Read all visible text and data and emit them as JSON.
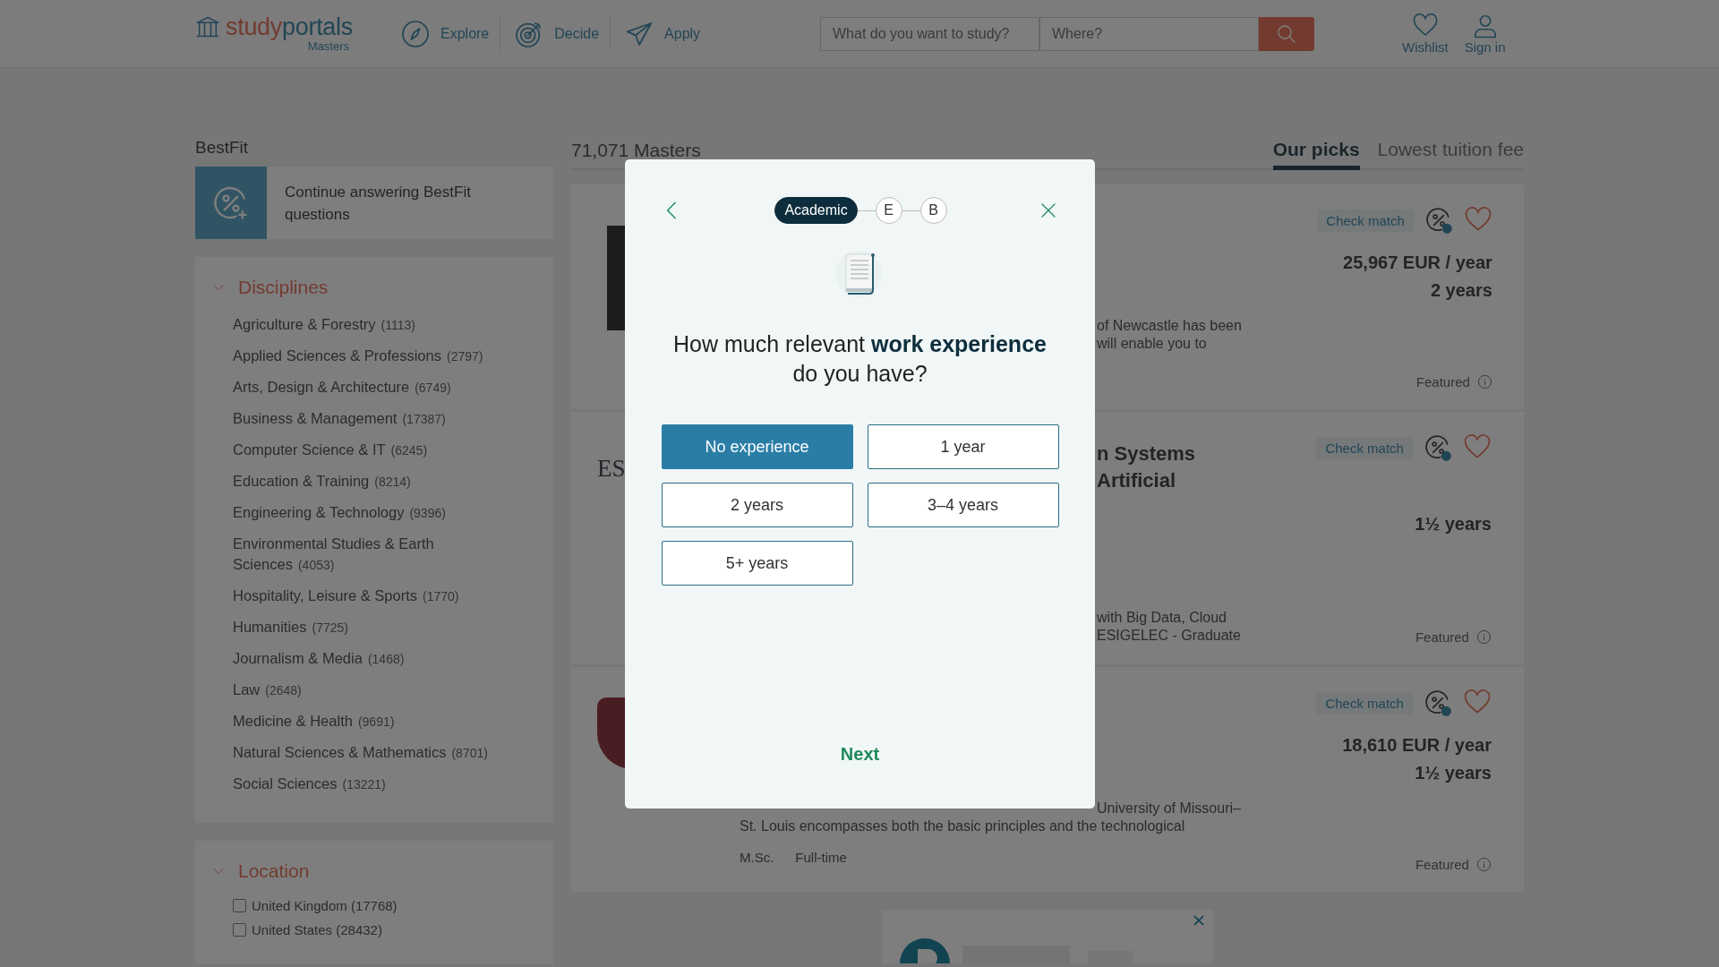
{
  "header": {
    "logo_parts": [
      "study",
      "portals"
    ],
    "logo_sub": "Masters",
    "nav": [
      {
        "label": "Explore"
      },
      {
        "label": "Decide"
      },
      {
        "label": "Apply"
      }
    ],
    "search": {
      "what_placeholder": "What do you want to study?",
      "where_placeholder": "Where?"
    },
    "actions": [
      {
        "label": "Wishlist"
      },
      {
        "label": "Sign in"
      }
    ]
  },
  "sidebar": {
    "bestfit_title": "BestFit",
    "bestfit_card": "Continue answering BestFit questions",
    "disciplines": {
      "title": "Disciplines",
      "expanded": true,
      "items": [
        {
          "name": "Agriculture & Forestry",
          "count": "(1113)"
        },
        {
          "name": "Applied Sciences & Professions",
          "count": "(2797)"
        },
        {
          "name": "Arts, Design & Architecture",
          "count": "(6749)"
        },
        {
          "name": "Business & Management",
          "count": "(17387)"
        },
        {
          "name": "Computer Science & IT",
          "count": "(6245)"
        },
        {
          "name": "Education & Training",
          "count": "(8214)"
        },
        {
          "name": "Engineering & Technology",
          "count": "(9396)"
        },
        {
          "name": "Environmental Studies & Earth Sciences",
          "count": "(4053)"
        },
        {
          "name": "Hospitality, Leisure & Sports",
          "count": "(1770)"
        },
        {
          "name": "Humanities",
          "count": "(7725)"
        },
        {
          "name": "Journalism & Media",
          "count": "(1468)"
        },
        {
          "name": "Law",
          "count": "(2648)"
        },
        {
          "name": "Medicine & Health",
          "count": "(9691)"
        },
        {
          "name": "Natural Sciences & Mathematics",
          "count": "(8701)"
        },
        {
          "name": "Social Sciences",
          "count": "(13221)"
        }
      ]
    },
    "location": {
      "title": "Location",
      "expanded": true,
      "items": [
        {
          "label": "United Kingdom (17768)",
          "checked": false
        },
        {
          "label": "United States (28432)",
          "checked": false
        }
      ]
    }
  },
  "results": {
    "count": "71,071 Masters",
    "tabs": [
      {
        "label": "Our picks",
        "selected": true
      },
      {
        "label": "Lowest tuition fee",
        "selected": false
      }
    ],
    "cards": [
      {
        "check_match": "Check match",
        "fee": "25,967 EUR / year",
        "duration": "2 years",
        "description_lines": [
          {
            "text": "of Newcastle has been",
            "covered": true
          },
          {
            "text": "will enable you to",
            "covered": true
          }
        ],
        "featured": "Featured"
      },
      {
        "logo_text": "ES",
        "title_lines": [
          {
            "text": "n Systems",
            "covered": true
          },
          {
            "text": "Artificial",
            "covered": true
          }
        ],
        "check_match": "Check match",
        "duration": "1½ years",
        "description_lines": [
          {
            "text": "with Big Data, Cloud",
            "covered": true
          },
          {
            "text": "ESIGELEC - Graduate",
            "covered": true
          }
        ],
        "featured": "Featured"
      },
      {
        "check_match": "Check match",
        "fee": "18,610 EUR / year",
        "duration": "1½ years",
        "description_lines": [
          {
            "text": "University of Missouri–",
            "covered": true
          },
          {
            "text": "St. Louis encompasses both the basic principles and the technological"
          }
        ],
        "meta": [
          "M.Sc.",
          "Full-time"
        ],
        "featured": "Featured"
      }
    ]
  },
  "modal": {
    "steps": [
      {
        "label": "Academic",
        "selected": true
      },
      {
        "label": "E",
        "selected": false
      },
      {
        "label": "B",
        "selected": false
      }
    ],
    "question": "How much relevant **work experience** do you have?",
    "options": [
      {
        "label": "No experience",
        "selected": true
      },
      {
        "label": "1 year",
        "selected": false
      },
      {
        "label": "2 years",
        "selected": false
      },
      {
        "label": "3–4 years",
        "selected": false
      },
      {
        "label": "5+ years",
        "selected": false
      }
    ],
    "next": "Next"
  }
}
